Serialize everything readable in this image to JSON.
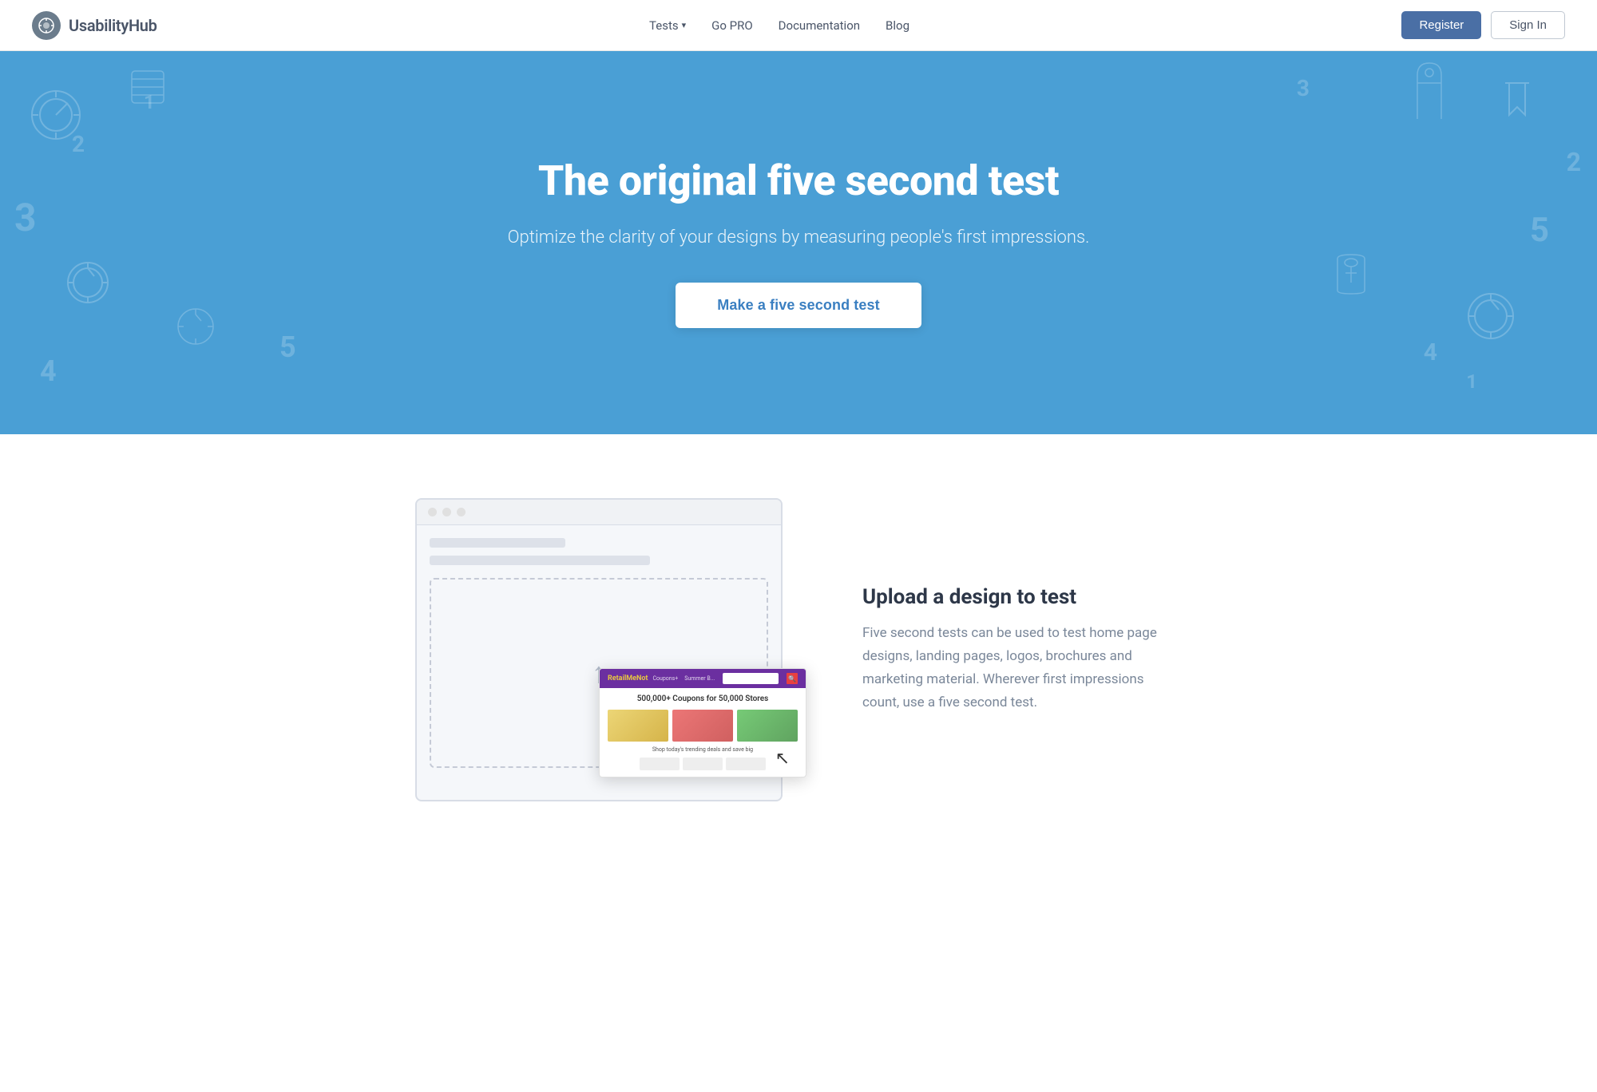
{
  "nav": {
    "logo_text": "UsabilityHub",
    "links": [
      {
        "id": "tests",
        "label": "Tests",
        "dropdown": true
      },
      {
        "id": "go-pro",
        "label": "Go PRO",
        "dropdown": false
      },
      {
        "id": "documentation",
        "label": "Documentation",
        "dropdown": false
      },
      {
        "id": "blog",
        "label": "Blog",
        "dropdown": false
      }
    ],
    "register_label": "Register",
    "signin_label": "Sign In"
  },
  "hero": {
    "title": "The original five second test",
    "subtitle": "Optimize the clarity of your designs by measuring people's first impressions.",
    "cta_label": "Make a five second test"
  },
  "section1": {
    "title": "Upload a design to test",
    "body": "Five second tests can be used to test home page designs, landing pages, logos, brochures and marketing material. Wherever first impressions count, use a five second test.",
    "screenshot_title": "500,000+ Coupons for 50,000 Stores",
    "screenshot_subtitle": "Shop today's trending deals and save big"
  }
}
